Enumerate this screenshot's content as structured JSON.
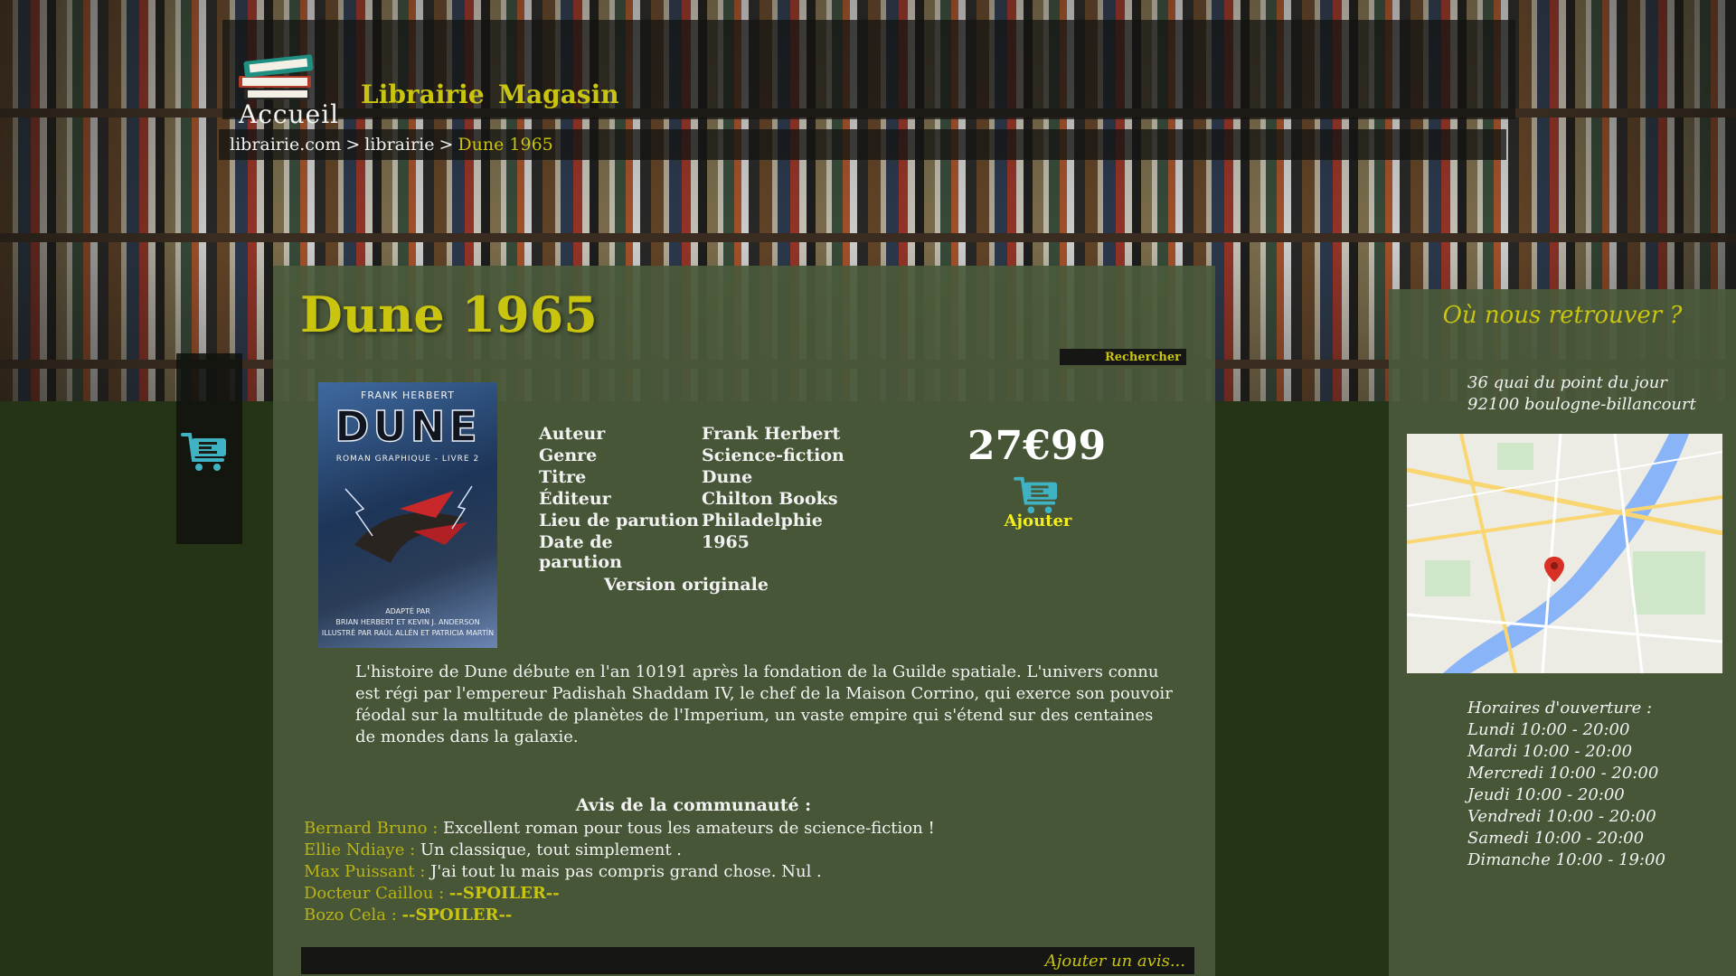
{
  "header": {
    "logo_label": "Accueil",
    "nav": [
      "Librairie",
      "Magasin"
    ]
  },
  "breadcrumb": {
    "items": [
      "librairie.com",
      "librairie"
    ],
    "separator": ">",
    "current": "Dune 1965"
  },
  "book": {
    "title": "Dune 1965",
    "search_label": "Rechercher",
    "cover": {
      "author": "FRANK HERBERT",
      "title": "DUNE",
      "subtitle": "ROMAN GRAPHIQUE - LIVRE 2",
      "credit_line1": "ADAPTÉ PAR",
      "credit_line2": "BRIAN HERBERT ET KEVIN J. ANDERSON",
      "credit_line3": "ILLUSTRÉ PAR RAÚL ALLÉN ET PATRICIA MARTÍN"
    },
    "specs": [
      {
        "label": "Auteur",
        "value": "Frank Herbert"
      },
      {
        "label": "Genre",
        "value": "Science-fiction"
      },
      {
        "label": "Titre",
        "value": "Dune"
      },
      {
        "label": "Éditeur",
        "value": "Chilton Books"
      },
      {
        "label": "Lieu de parution",
        "value": "Philadelphie"
      },
      {
        "label": "Date de parution",
        "value": "1965"
      }
    ],
    "edition": "Version originale",
    "price": "27€99",
    "add_to_cart_label": "Ajouter",
    "description": "L'histoire de Dune débute en l'an 10191 après la fondation de la Guilde spatiale. L'univers connu est régi par l'empereur Padishah Shaddam IV, le chef de la Maison Corrino, qui exerce son pouvoir féodal sur la multitude de planètes de l'Imperium, un vaste empire qui s'étend sur des centaines de mondes dans la galaxie."
  },
  "reviews": {
    "title": "Avis de la communauté :",
    "items": [
      {
        "author": "Bernard Bruno :",
        "text": "Excellent roman pour tous les amateurs de science-fiction !",
        "spoiler": ""
      },
      {
        "author": "Ellie Ndiaye :",
        "text": "Un classique, tout simplement .",
        "spoiler": ""
      },
      {
        "author": "Max Puissant :",
        "text": "J'ai tout lu mais pas compris grand chose. Nul .",
        "spoiler": ""
      },
      {
        "author": "Docteur Caillou :",
        "text": "",
        "spoiler": "--SPOILER--"
      },
      {
        "author": "Bozo Cela :",
        "text": "",
        "spoiler": "--SPOILER--"
      }
    ],
    "add_review_label": "Ajouter un avis..."
  },
  "location": {
    "title": "Où nous retrouver ?",
    "address_line1": "36 quai du point du jour",
    "address_line2": "92100 boulogne-billancourt",
    "hours_title": "Horaires d'ouverture :",
    "hours": [
      "Lundi 10:00 - 20:00",
      "Mardi 10:00 - 20:00",
      "Mercredi 10:00 - 20:00",
      "Jeudi 10:00 - 20:00",
      "Vendredi 10:00 - 20:00",
      "Samedi 10:00 - 20:00",
      "Dimanche 10:00 - 19:00"
    ]
  },
  "colors": {
    "accent": "#c8c410",
    "panel": "#4a593a",
    "page_bg": "#253316",
    "cart_icon": "#3fb3c4"
  },
  "icons": {
    "logo": "books-stack-icon",
    "cart": "shopping-cart-icon",
    "map_pin": "map-pin-icon"
  }
}
